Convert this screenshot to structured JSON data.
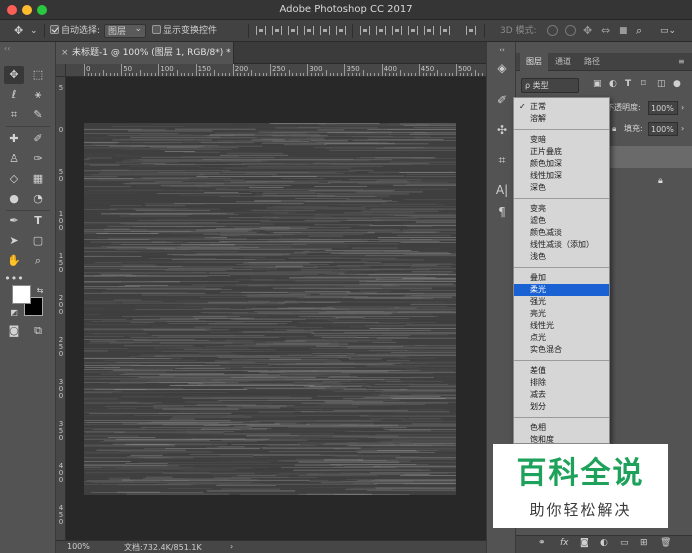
{
  "app": {
    "title": "Adobe Photoshop CC 2017"
  },
  "options_bar": {
    "auto_select_label": "自动选择:",
    "auto_select_target": "图层",
    "show_transform_label": "显示变换控件",
    "mode_3d_label": "3D 模式:"
  },
  "document": {
    "tab_title": "未标题-1 @ 100% (图层 1, RGB/8*) *",
    "close_glyph": "×"
  },
  "ruler": {
    "top_labels": [
      "0",
      "50",
      "100",
      "150",
      "200",
      "250",
      "300",
      "350",
      "400",
      "450",
      "500"
    ],
    "left_labels": [
      "5",
      "0",
      "5 0",
      "1 0 0",
      "1 5 0",
      "2 0 0",
      "2 5 0",
      "3 0 0",
      "3 5 0",
      "4 0 0",
      "4 5 0"
    ]
  },
  "status": {
    "zoom": "100%",
    "doc_info": "文档:732.4K/851.1K",
    "arrow": "›"
  },
  "tools": {
    "foreground_color": "#ffffff",
    "background_color": "#000000"
  },
  "layers_panel": {
    "tabs": [
      "图层",
      "通道",
      "路径"
    ],
    "filter_label": "ρ 类型",
    "opacity_label": "不透明度:",
    "opacity_value": "100%",
    "lock_label": "锁",
    "fill_label": "填充:",
    "fill_value": "100%"
  },
  "blend_modes": {
    "checked": "正常",
    "selected": "柔光",
    "groups": [
      [
        "正常",
        "溶解"
      ],
      [
        "变暗",
        "正片叠底",
        "颜色加深",
        "线性加深",
        "深色"
      ],
      [
        "变亮",
        "滤色",
        "颜色减淡",
        "线性减淡（添加）",
        "浅色"
      ],
      [
        "叠加",
        "柔光",
        "强光",
        "亮光",
        "线性光",
        "点光",
        "实色混合"
      ],
      [
        "差值",
        "排除",
        "减去",
        "划分"
      ],
      [
        "色相",
        "饱和度"
      ]
    ]
  },
  "watermark": {
    "title": "百科全说",
    "subtitle": "助你轻松解决",
    "title_color": "#1ea15a"
  }
}
